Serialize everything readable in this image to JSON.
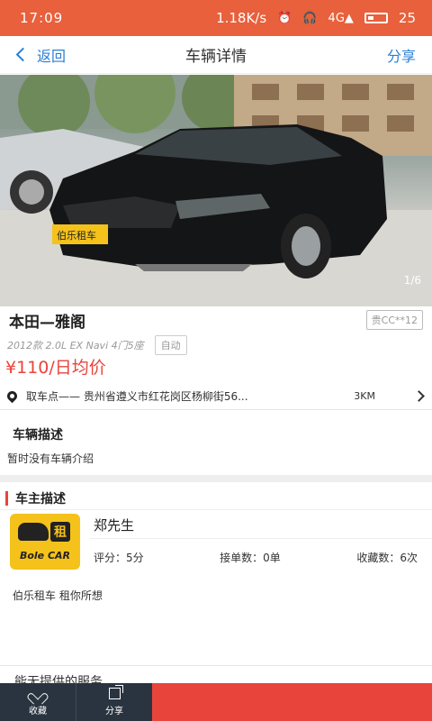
{
  "status_bar": {
    "time": "17:09",
    "network_speed": "1.18K/s",
    "signal": "4G",
    "battery": "25"
  },
  "nav": {
    "back_label": "返回",
    "title": "车辆详情",
    "share_label": "分享"
  },
  "hero": {
    "counter": "1/6",
    "sign_text": "伯乐租车"
  },
  "car": {
    "title": "本田—雅阁",
    "plate": "贵CC**12",
    "spec": "2012款 2.0L EX Navi 4门5座",
    "transmission": "自动",
    "price": "¥110/日均价"
  },
  "pickup": {
    "address": "取车点—— 贵州省遵义市红花岗区杨柳街56...",
    "distance": "3KM"
  },
  "vehicle_desc": {
    "title": "车辆描述",
    "body": "暂时没有车辆介绍"
  },
  "owner": {
    "section_title": "车主描述",
    "name": "郑先生",
    "logo_char": "租",
    "logo_text": "Bole CAR",
    "rating": "评分：5分",
    "orders": "接单数：0单",
    "favorites": "收藏数：6次",
    "description": "伯乐租车 租你所想"
  },
  "cut_off_text": "能无提供的服务",
  "bottom_bar": {
    "fav_label": "收藏",
    "share_label": "分享",
    "book_label": ""
  },
  "colors": {
    "brand": "#e8603c",
    "accent_red": "#e8443c",
    "link_blue": "#2a7fd4",
    "dark_bar": "#2a3440"
  }
}
